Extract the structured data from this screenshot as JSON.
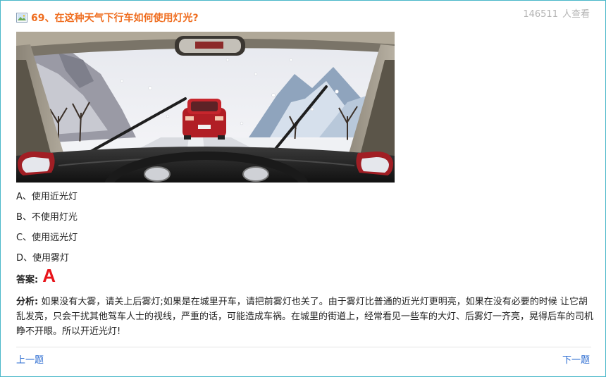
{
  "header": {
    "view_count": "146511",
    "view_suffix": "人查看"
  },
  "question": {
    "title": "69、在这种天气下行车如何使用灯光?",
    "options": [
      "A、使用近光灯",
      "B、不使用灯光",
      "C、使用远光灯",
      "D、使用雾灯"
    ]
  },
  "answer": {
    "label": "答案:",
    "value": "A"
  },
  "analysis": {
    "label": "分析:",
    "text": "如果没有大雾，请关上后雾灯;如果是在城里开车，请把前雾灯也关了。由于雾灯比普通的近光灯更明亮，如果在没有必要的时候 让它胡乱发亮，只会干扰其他驾车人士的视线，严重的话，可能造成车祸。在城里的街道上，经常看见一些车的大灯、后雾灯一齐亮，晃得后车的司机睁不开眼。所以开近光灯!"
  },
  "nav": {
    "prev": "上一题",
    "next": "下一题"
  },
  "colors": {
    "title": "#ef6d1f",
    "answer": "#e8141a",
    "link": "#2a6bd1",
    "border": "#49b7c9"
  }
}
